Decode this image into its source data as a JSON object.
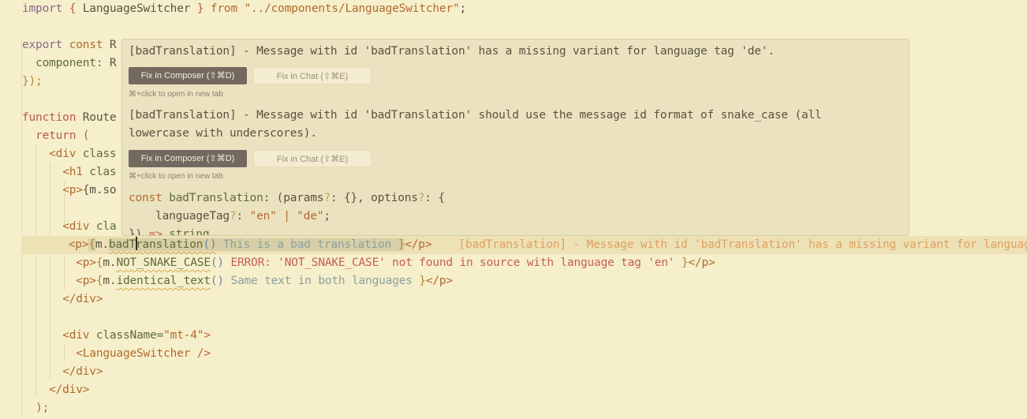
{
  "editor": {
    "line1": {
      "kw": "import",
      "open": "{",
      "name": " LanguageSwitcher ",
      "close": "}",
      "from": "from",
      "path": "\"../components/LanguageSwitcher\"",
      "end": ";"
    },
    "line2": {
      "kw": "export",
      "kw2": "const",
      "rest": "R"
    },
    "line3": {
      "prop": "component:",
      "rest": " R"
    },
    "line4": {
      "text": "});"
    },
    "line5": {
      "kw": "function",
      "rest": " Route"
    },
    "line6": {
      "kw": "return",
      "rest": " ("
    },
    "line7": {
      "tag": "<div",
      "rest": " class"
    },
    "line8": {
      "tag": "<h1",
      "rest": " clas"
    },
    "line9": {
      "tag": "<p>",
      "rest": "{m.so"
    },
    "line10": {
      "tag": "<div",
      "rest": " cla"
    },
    "line11": {
      "open_tag": "<p>",
      "brace": "{",
      "obj": "m.",
      "fn_a": "badT",
      "fn_b": "ranslation",
      "parens": "()",
      "hint": " This is a bad translation ",
      "close_brace": "}",
      "close_tag": "</p>",
      "inline_diagnostic": "[badTranslation] - Message with id 'badTranslation' has a missing variant for language tag 'de'."
    },
    "line12": {
      "open_tag": "<p>",
      "brace": "{",
      "obj": "m.",
      "fn": "NOT_SNAKE_CASE",
      "parens": "()",
      "hint": " ERROR: 'NOT_SNAKE_CASE' not found in source with language tag 'en' ",
      "close_brace": "}",
      "close_tag": "</p>"
    },
    "line13": {
      "open_tag": "<p>",
      "brace": "{",
      "obj": "m.",
      "fn": "identical_text",
      "parens": "()",
      "hint": " Same text in both languages ",
      "close_brace": "}",
      "close_tag": "</p>"
    },
    "line14": {
      "text": "</div>"
    },
    "line16": {
      "tag": "<div",
      "attr": " className=",
      "val": "\"mt-4\"",
      "end": ">"
    },
    "line17": {
      "text": "<LanguageSwitcher />"
    },
    "line18": {
      "text": "</div>"
    },
    "line19": {
      "text": "</div>"
    },
    "line20": {
      "text": ");"
    }
  },
  "popup": {
    "diagnostics": [
      {
        "message": "[badTranslation] - Message with id 'badTranslation' has a missing variant for language tag 'de'.",
        "primary_button": "Fix in Composer (⇧⌘D)",
        "secondary_button": "Fix in Chat (⇧⌘E)",
        "hint": "⌘+click to open in new tab"
      },
      {
        "message_line1": "[badTranslation] - Message with id 'badTranslation' should use the message id format of snake_case (all",
        "message_line2": "lowercase with underscores).",
        "primary_button": "Fix in Composer (⇧⌘D)",
        "secondary_button": "Fix in Chat (⇧⌘E)",
        "hint": "⌘+click to open in new tab"
      }
    ],
    "signature": {
      "kw": "const",
      "name": " badTranslation",
      "p1": ": (params",
      "q1": "?",
      "p2": ": {}, options",
      "q2": "?",
      "p3": ": {",
      "l2a": "    languageTag",
      "l2q": "?",
      "l2b": ": ",
      "en": "\"en\"",
      "pipe": " | ",
      "de": "\"de\"",
      "l2end": ";",
      "l3a": "}) ",
      "l3arrow": "=>",
      "l3b": " string"
    }
  }
}
